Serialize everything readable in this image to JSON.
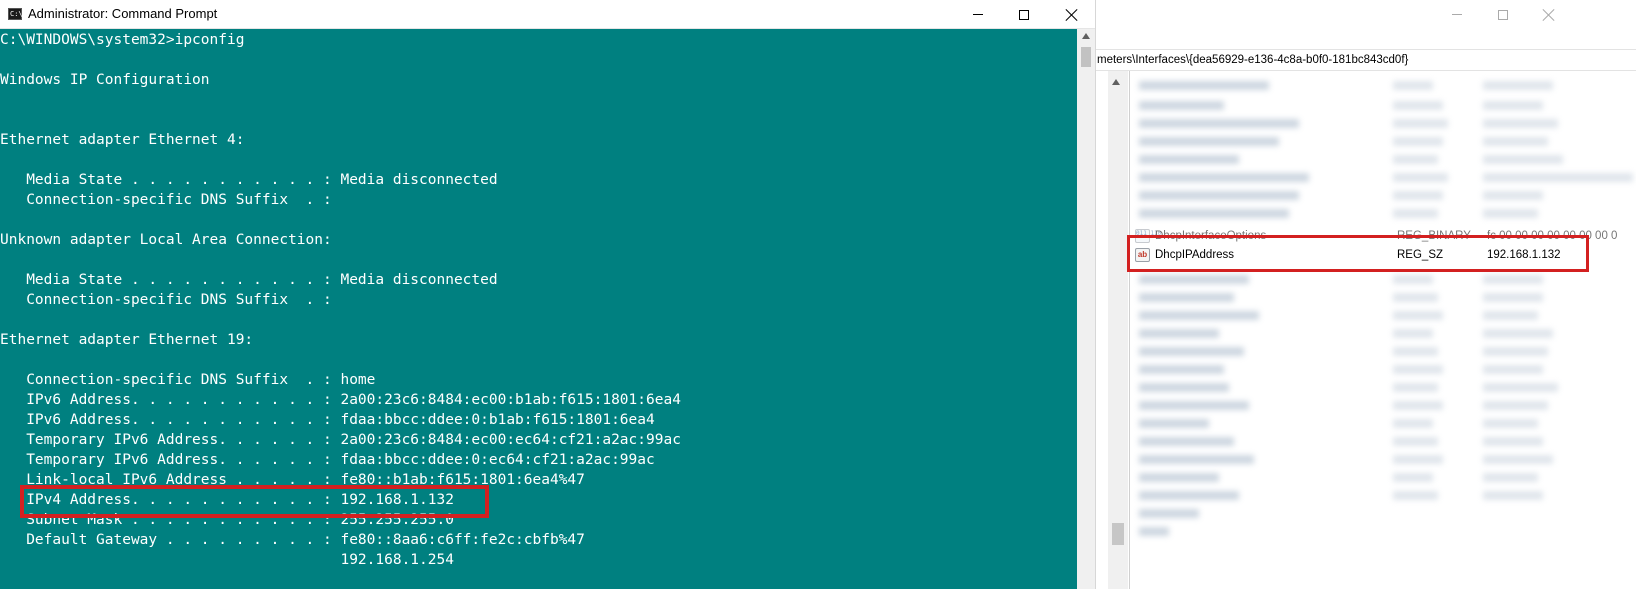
{
  "cmd": {
    "title": "Administrator: Command Prompt",
    "icon_label": "C:\\",
    "lines": [
      "C:\\WINDOWS\\system32>ipconfig",
      "",
      "Windows IP Configuration",
      "",
      "",
      "Ethernet adapter Ethernet 4:",
      "",
      "   Media State . . . . . . . . . . . : Media disconnected",
      "   Connection-specific DNS Suffix  . :",
      "",
      "Unknown adapter Local Area Connection:",
      "",
      "   Media State . . . . . . . . . . . : Media disconnected",
      "   Connection-specific DNS Suffix  . :",
      "",
      "Ethernet adapter Ethernet 19:",
      "",
      "   Connection-specific DNS Suffix  . : home",
      "   IPv6 Address. . . . . . . . . . . : 2a00:23c6:8484:ec00:b1ab:f615:1801:6ea4",
      "   IPv6 Address. . . . . . . . . . . : fdaa:bbcc:ddee:0:b1ab:f615:1801:6ea4",
      "   Temporary IPv6 Address. . . . . . : 2a00:23c6:8484:ec00:ec64:cf21:a2ac:99ac",
      "   Temporary IPv6 Address. . . . . . : fdaa:bbcc:ddee:0:ec64:cf21:a2ac:99ac",
      "   Link-local IPv6 Address . . . . . : fe80::b1ab:f615:1801:6ea4%47",
      "   IPv4 Address. . . . . . . . . . . : 192.168.1.132",
      "   Subnet Mask . . . . . . . . . . . : 255.255.255.0",
      "   Default Gateway . . . . . . . . . : fe80::8aa6:c6ff:fe2c:cbfb%47",
      "                                       192.168.1.254"
    ]
  },
  "registry": {
    "address_path": "meters\\Interfaces\\{dea56929-e136-4c8a-b0f0-181bc843cd0f}",
    "partial_row": {
      "name": "DhcpInterfaceOptions",
      "type": "REG_BINARY",
      "data": "fc 00 00 00 00 00 00 00 0",
      "icon": "binary-value-icon",
      "icon_glyph": "011\n110"
    },
    "highlight_row": {
      "name": "DhcpIPAddress",
      "type": "REG_SZ",
      "data": "192.168.1.132",
      "icon": "string-value-icon",
      "icon_glyph": "ab"
    }
  },
  "colors": {
    "console_background": "#008080",
    "console_text": "#ffffff",
    "highlight_border": "#d32020"
  }
}
